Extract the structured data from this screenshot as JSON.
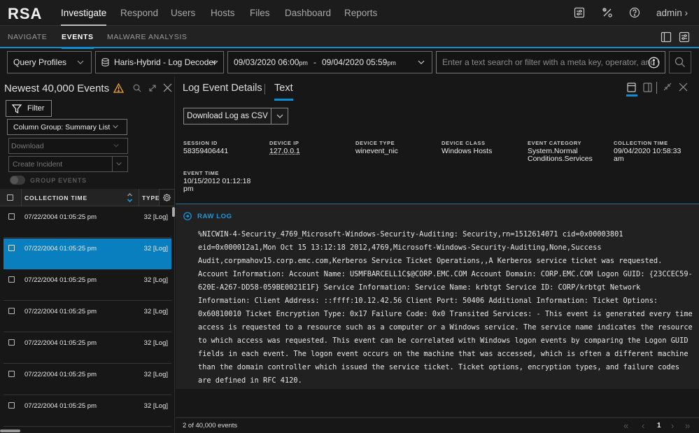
{
  "app": {
    "logo": "RSA",
    "nav": [
      "Investigate",
      "Respond",
      "Users",
      "Hosts",
      "Files",
      "Dashboard",
      "Reports"
    ],
    "active_nav": "Investigate",
    "user": "admin",
    "user_chevron": "›",
    "icons": [
      "settings-sliders-icon",
      "tools-icon",
      "help-icon"
    ]
  },
  "subnav": {
    "items": [
      "NAVIGATE",
      "EVENTS",
      "MALWARE ANALYSIS"
    ],
    "active": "EVENTS",
    "icons": [
      "panel-layout-icon",
      "settings-sliders-icon"
    ]
  },
  "querybar": {
    "profiles_label": "Query Profiles",
    "service_label": "Haris-Hybrid - Log Decoder",
    "range_start_date": "09/03/2020 06:00",
    "range_start_ampm": "pm",
    "range_sep": "-",
    "range_end_date": "09/04/2020 05:59",
    "range_end_ampm": "pm",
    "search_placeholder": "Enter a text search or filter with a meta key, operator, and v"
  },
  "events_panel": {
    "title": "Newest 40,000 Events",
    "warning_color": "#f5a623",
    "filter_label": "Filter",
    "column_group": "Column Group: Summary List",
    "download_label": "Download",
    "create_incident_label": "Create Incident",
    "group_events_label": "GROUP EVENTS",
    "group_events_enabled": false,
    "columns": [
      "COLLECTION TIME",
      "TYPE"
    ],
    "rows": [
      {
        "time": "07/22/2004 01:05:25 pm",
        "type": "32 [Log]",
        "selected": false
      },
      {
        "time": "07/22/2004 01:05:25 pm",
        "type": "32 [Log]",
        "selected": true
      },
      {
        "time": "07/22/2004 01:05:25 pm",
        "type": "32 [Log]",
        "selected": false
      },
      {
        "time": "07/22/2004 01:05:25 pm",
        "type": "32 [Log]",
        "selected": false
      },
      {
        "time": "07/22/2004 01:05:25 pm",
        "type": "32 [Log]",
        "selected": false
      },
      {
        "time": "07/22/2004 01:05:25 pm",
        "type": "32 [Log]",
        "selected": false
      },
      {
        "time": "07/22/2004 01:05:25 pm",
        "type": "32 [Log]",
        "selected": false
      }
    ],
    "selected_color": "#0a7fc0"
  },
  "details_panel": {
    "tabs": [
      "Log Event Details",
      "Text"
    ],
    "active_tab": "Text",
    "download_button": "Download Log as CSV",
    "meta": [
      {
        "key": "SESSION ID",
        "value": "58359406441"
      },
      {
        "key": "DEVICE IP",
        "value": "127.0.0.1"
      },
      {
        "key": "DEVICE TYPE",
        "value": "winevent_nic"
      },
      {
        "key": "DEVICE CLASS",
        "value": "Windows Hosts"
      },
      {
        "key": "EVENT CATEGORY",
        "value": "System.Normal\nConditions.Services"
      },
      {
        "key": "COLLECTION TIME",
        "value": "09/04/2020 10:58:33\nam"
      },
      {
        "key": "EVENT TIME",
        "value": "10/15/2012 01:12:18\npm"
      }
    ],
    "raw_log_label": "RAW LOG",
    "raw_log_lines": [
      "%NICWIN-4-Security_4769_Microsoft-Windows-Security-Auditing: Security,rn=1512614071 cid=0x00003801",
      "eid=0x000012a1,Mon Oct 15 13:12:18 2012,4769,Microsoft-Windows-Security-Auditing,None,Success",
      "Audit,corpmahov15.corp.emc.com,Kerberos Service Ticket Operations,,A Kerberos service ticket was requested.",
      "Account Information: Account Name: USMFBARCELL1C$@CORP.EMC.COM Account Domain: CORP.EMC.COM Logon GUID: {23CCEC59-",
      "620E-A267-DD58-059BE0021E1F} Service Information: Service Name: krbtgt Service ID: CORP/krbtgt Network",
      "Information: Client Address: ::ffff:10.12.42.56 Client Port: 50406 Additional Information: Ticket Options:",
      "0x60810010 Ticket Encryption Type: 0x17 Failure Code: 0x0 Transited Services: - This event is generated every time",
      "access is requested to a resource such as a computer or a Windows service. The service name indicates the resource",
      "to which access was requested. This event can be correlated with Windows logon events by comparing the Logon GUID",
      "fields in each event. The logon event occurs on the machine that was accessed, which is often a different machine",
      "than the domain controller which issued the service ticket. Ticket options, encryption types, and failure codes",
      "are defined in RFC 4120."
    ],
    "footer": {
      "count": "2 of 40,000 events",
      "current_page": "1"
    }
  },
  "colors": {
    "accent": "#0a8fd0",
    "background": "#171717",
    "raw_log_bg": "#212121"
  }
}
